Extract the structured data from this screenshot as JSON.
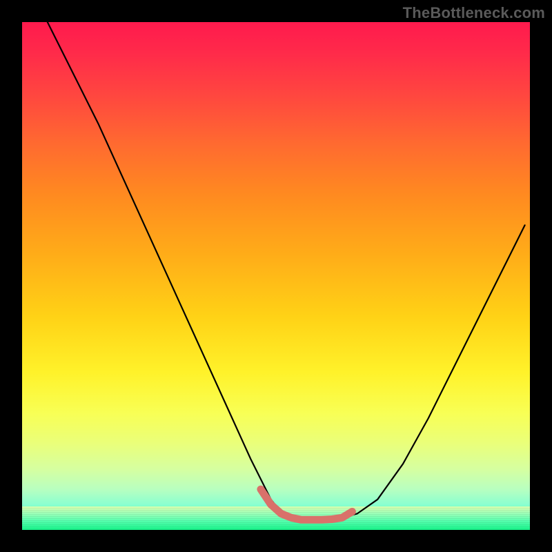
{
  "watermark": "TheBottleneck.com",
  "colors": {
    "background": "#000000",
    "curve": "#000000",
    "highlight": "#d9716a"
  },
  "chart_data": {
    "type": "line",
    "title": "",
    "xlabel": "",
    "ylabel": "",
    "xlim": [
      0,
      100
    ],
    "ylim": [
      0,
      100
    ],
    "grid": false,
    "legend": false,
    "series": [
      {
        "name": "curve",
        "x": [
          5,
          10,
          15,
          20,
          25,
          30,
          35,
          40,
          45,
          47,
          49,
          51,
          53,
          55,
          57,
          59,
          61,
          63,
          66,
          70,
          75,
          80,
          85,
          90,
          95,
          99
        ],
        "y": [
          100,
          90,
          80,
          69,
          58,
          47,
          36,
          25,
          14,
          10,
          6,
          3.5,
          2.4,
          2,
          2,
          2,
          2.1,
          2.4,
          3.2,
          6,
          13,
          22,
          32,
          42,
          52,
          60
        ]
      },
      {
        "name": "highlight",
        "x": [
          47,
          49,
          51,
          53,
          55,
          57,
          59,
          61,
          63,
          65
        ],
        "y": [
          8,
          5,
          3.2,
          2.4,
          2,
          2,
          2,
          2.1,
          2.4,
          3.6
        ]
      }
    ]
  }
}
